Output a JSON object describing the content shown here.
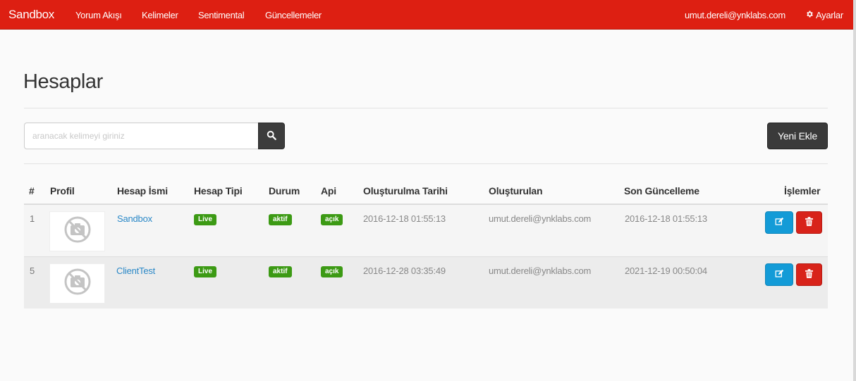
{
  "navbar": {
    "brand": "Sandbox",
    "links": [
      "Yorum Akışı",
      "Kelimeler",
      "Sentimental",
      "Güncellemeler"
    ],
    "user_email": "umut.dereli@ynklabs.com",
    "settings_label": "Ayarlar",
    "settings_icon": "gear-icon",
    "bg_color": "#dd1f12"
  },
  "page": {
    "title": "Hesaplar"
  },
  "search": {
    "placeholder": "aranacak kelimeyi giriniz",
    "value": "",
    "button_icon": "search-icon"
  },
  "add_button_label": "Yeni Ekle",
  "table": {
    "headers": [
      "#",
      "Profil",
      "Hesap İsmi",
      "Hesap Tipi",
      "Durum",
      "Api",
      "Oluşturulma Tarihi",
      "Oluşturulan",
      "Son Güncelleme",
      "İşlemler"
    ],
    "rows": [
      {
        "id": "1",
        "profile_icon": "no-photo-icon",
        "name": "Sandbox",
        "type": "Live",
        "status": "aktif",
        "api": "açık",
        "created": "2016-12-18 01:55:13",
        "creator": "umut.dereli@ynklabs.com",
        "updated": "2016-12-18 01:55:13"
      },
      {
        "id": "5",
        "profile_icon": "no-photo-icon",
        "name": "ClientTest",
        "type": "Live",
        "status": "aktif",
        "api": "açık",
        "created": "2016-12-28 03:35:49",
        "creator": "umut.dereli@ynklabs.com",
        "updated": "2021-12-19 00:50:04"
      }
    ]
  }
}
